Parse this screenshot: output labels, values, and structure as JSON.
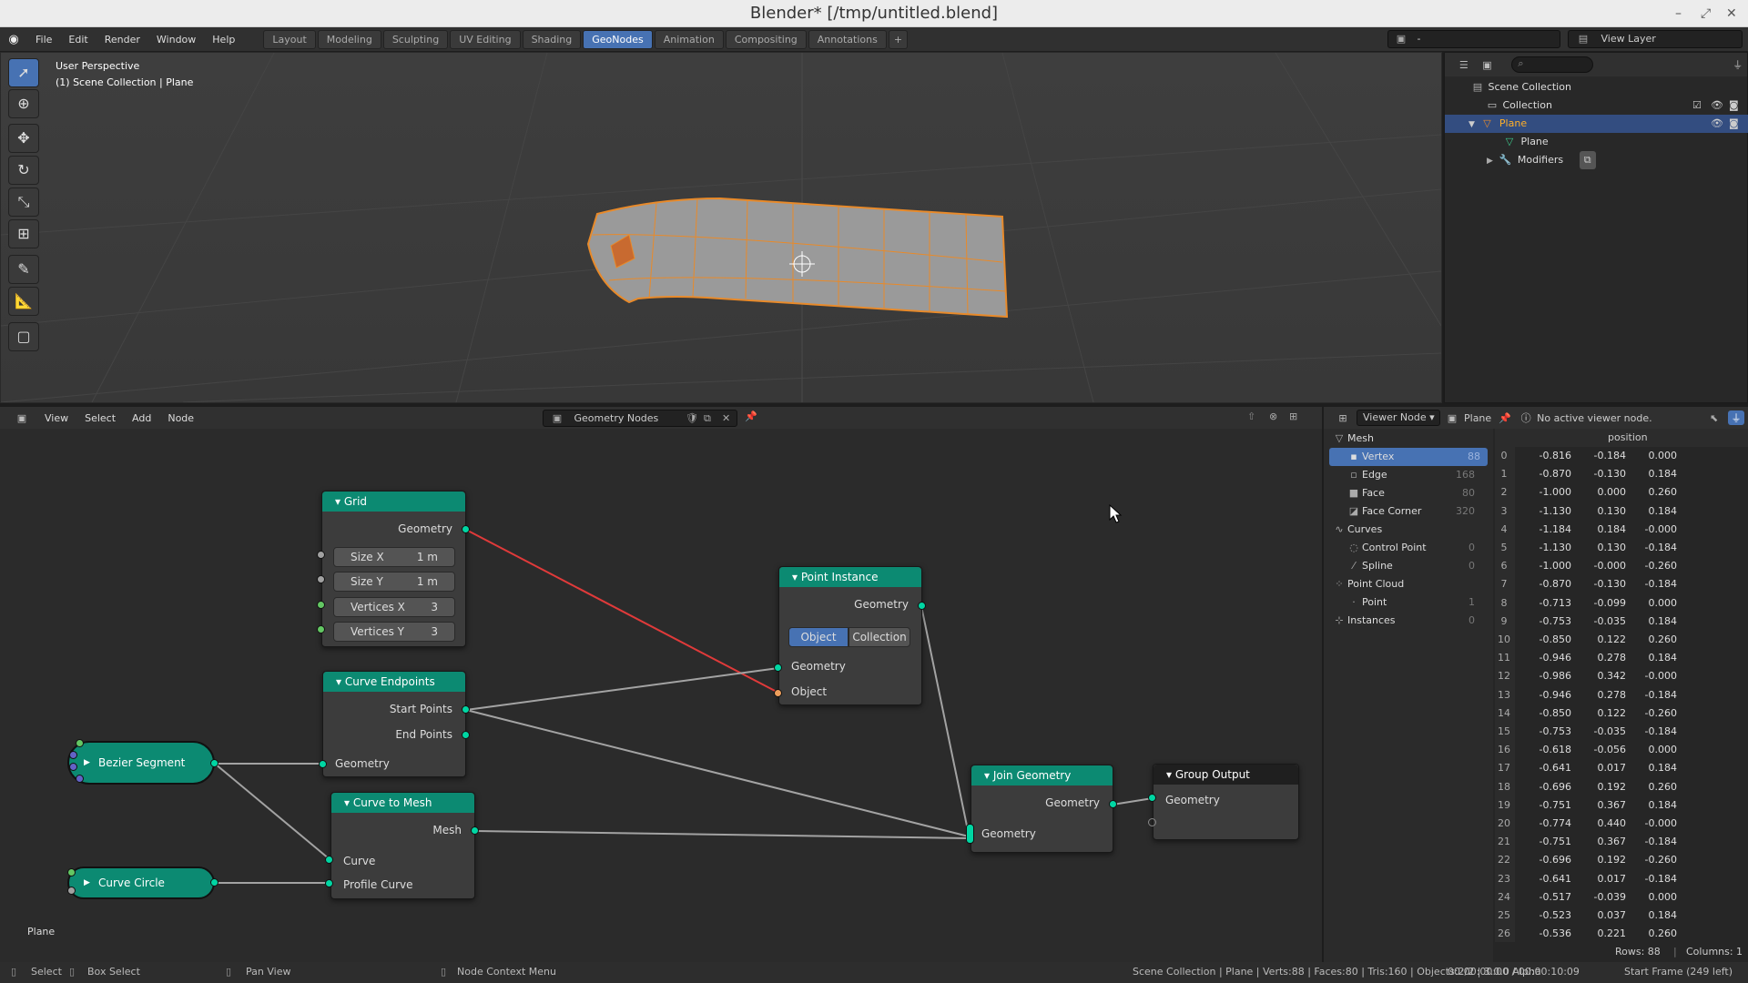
{
  "window": {
    "title": "Blender* [/tmp/untitled.blend]"
  },
  "menubar": {
    "items": [
      "File",
      "Edit",
      "Render",
      "Window",
      "Help"
    ]
  },
  "workspaces": {
    "tabs": [
      "Layout",
      "Modeling",
      "Sculpting",
      "UV Editing",
      "Shading",
      "GeoNodes",
      "Animation",
      "Compositing",
      "Annotations"
    ],
    "active": "GeoNodes",
    "add": "+"
  },
  "scene_field": {
    "value": "-"
  },
  "view_layer": {
    "value": "View Layer"
  },
  "viewport": {
    "line1": "User Perspective",
    "line2": "(1) Scene Collection | Plane"
  },
  "outliner": {
    "search_placeholder": "",
    "rows": [
      {
        "label": "Scene Collection"
      },
      {
        "label": "Collection"
      },
      {
        "label": "Plane"
      },
      {
        "label": "Plane"
      },
      {
        "label": "Modifiers"
      }
    ]
  },
  "node_editor": {
    "menus": [
      "View",
      "Select",
      "Add",
      "Node"
    ],
    "tree_name": "Geometry Nodes",
    "object_label": "Plane"
  },
  "nodes": {
    "grid": {
      "title": "Grid",
      "output": "Geometry",
      "size_x_label": "Size X",
      "size_x": "1 m",
      "size_y_label": "Size Y",
      "size_y": "1 m",
      "verts_x_label": "Vertices X",
      "verts_x": "3",
      "verts_y_label": "Vertices Y",
      "verts_y": "3"
    },
    "curve_endpoints": {
      "title": "Curve Endpoints",
      "start": "Start Points",
      "end": "End Points",
      "input": "Geometry"
    },
    "point_instance": {
      "title": "Point Instance",
      "output": "Geometry",
      "mode_object": "Object",
      "mode_collection": "Collection",
      "in_geometry": "Geometry",
      "in_object": "Object"
    },
    "curve_to_mesh": {
      "title": "Curve to Mesh",
      "output": "Mesh",
      "in_curve": "Curve",
      "in_profile": "Profile Curve"
    },
    "join_geometry": {
      "title": "Join Geometry",
      "output": "Geometry",
      "input": "Geometry"
    },
    "group_output": {
      "title": "Group Output",
      "input": "Geometry"
    },
    "bezier": {
      "title": "Bezier Segment"
    },
    "circle": {
      "title": "Curve Circle"
    }
  },
  "spreadsheet": {
    "mode": "Viewer Node",
    "object": "Plane",
    "message": "No active viewer node.",
    "column": "position",
    "tree": [
      {
        "label": "Mesh",
        "count": ""
      },
      {
        "label": "Vertex",
        "count": "88"
      },
      {
        "label": "Edge",
        "count": "168"
      },
      {
        "label": "Face",
        "count": "80"
      },
      {
        "label": "Face Corner",
        "count": "320"
      },
      {
        "label": "Curves",
        "count": ""
      },
      {
        "label": "Control Point",
        "count": "0"
      },
      {
        "label": "Spline",
        "count": "0"
      },
      {
        "label": "Point Cloud",
        "count": ""
      },
      {
        "label": "Point",
        "count": "1"
      },
      {
        "label": "Instances",
        "count": "0"
      }
    ],
    "rows": [
      [
        "0",
        "-0.816",
        "-0.184",
        "0.000"
      ],
      [
        "1",
        "-0.870",
        "-0.130",
        "0.184"
      ],
      [
        "2",
        "-1.000",
        "0.000",
        "0.260"
      ],
      [
        "3",
        "-1.130",
        "0.130",
        "0.184"
      ],
      [
        "4",
        "-1.184",
        "0.184",
        "-0.000"
      ],
      [
        "5",
        "-1.130",
        "0.130",
        "-0.184"
      ],
      [
        "6",
        "-1.000",
        "-0.000",
        "-0.260"
      ],
      [
        "7",
        "-0.870",
        "-0.130",
        "-0.184"
      ],
      [
        "8",
        "-0.713",
        "-0.099",
        "0.000"
      ],
      [
        "9",
        "-0.753",
        "-0.035",
        "0.184"
      ],
      [
        "10",
        "-0.850",
        "0.122",
        "0.260"
      ],
      [
        "11",
        "-0.946",
        "0.278",
        "0.184"
      ],
      [
        "12",
        "-0.986",
        "0.342",
        "-0.000"
      ],
      [
        "13",
        "-0.946",
        "0.278",
        "-0.184"
      ],
      [
        "14",
        "-0.850",
        "0.122",
        "-0.260"
      ],
      [
        "15",
        "-0.753",
        "-0.035",
        "-0.184"
      ],
      [
        "16",
        "-0.618",
        "-0.056",
        "0.000"
      ],
      [
        "17",
        "-0.641",
        "0.017",
        "0.184"
      ],
      [
        "18",
        "-0.696",
        "0.192",
        "0.260"
      ],
      [
        "19",
        "-0.751",
        "0.367",
        "0.184"
      ],
      [
        "20",
        "-0.774",
        "0.440",
        "-0.000"
      ],
      [
        "21",
        "-0.751",
        "0.367",
        "-0.184"
      ],
      [
        "22",
        "-0.696",
        "0.192",
        "-0.260"
      ],
      [
        "23",
        "-0.641",
        "0.017",
        "-0.184"
      ],
      [
        "24",
        "-0.517",
        "-0.039",
        "0.000"
      ],
      [
        "25",
        "-0.523",
        "0.037",
        "0.184"
      ],
      [
        "26",
        "-0.536",
        "0.221",
        "0.260"
      ]
    ],
    "footer_rows": "Rows: 88",
    "footer_cols": "Columns: 1"
  },
  "statusbar": {
    "select": "Select",
    "box_select": "Box Select",
    "pan_view": "Pan View",
    "context_menu": "Node Context Menu",
    "stats": "Scene Collection | Plane | Verts:88 | Faces:80 | Tris:160 | Objects:2/2 | 3.0.0 Alpha",
    "time": "00:00:00:00 / 00:00:10:09",
    "frame": "Start Frame (249 left)"
  }
}
